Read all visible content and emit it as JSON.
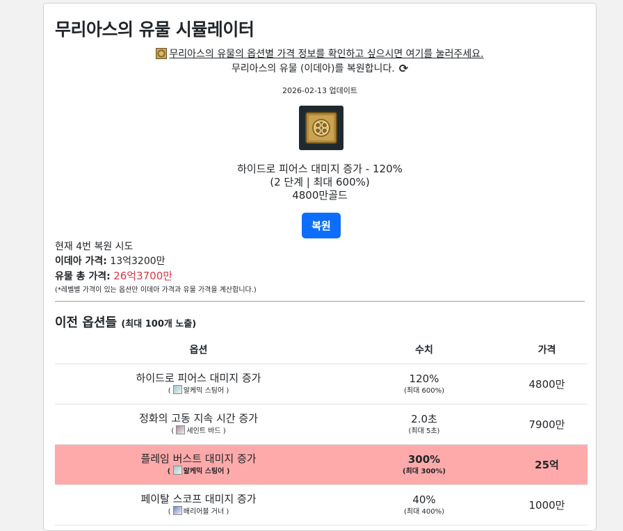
{
  "page": {
    "title": "무리아스의 유물 시뮬레이터",
    "link_text": "무리아스의 유물의 옵션별 가격 정보를 확인하고 싶으시면 여기를 눌러주세요.",
    "description": "무리아스의 유물 (이데아)를 복원합니다.",
    "update_text": "2026-02-13 업데이트"
  },
  "current_option": {
    "line1": "하이드로 피어스 대미지 증가 - 120%",
    "line2": "(2 단계 | 최대 600%)",
    "line3": "4800만골드"
  },
  "restore_button_label": "복원",
  "stats": {
    "attempts_text": "현재 4번 복원 시도",
    "idea_label": "이데아 가격:",
    "idea_value": "13억3200만",
    "total_label": "유물 총 가격:",
    "total_value": "26억3700만",
    "note": "(*레벨별 가격이 있는 옵션만 이데아 가격과 유물 가격을 계산합니다.)"
  },
  "history": {
    "heading": "이전 옵션들",
    "heading_small": "(최대 100개 노출)",
    "columns": [
      "옵션",
      "수치",
      "가격"
    ],
    "rows": [
      {
        "name": "하이드로 피어스 대미지 증가",
        "source": "알케믹 스팅어",
        "value": "120%",
        "max": "(최대 600%)",
        "price": "4800만",
        "gem_color": "#9cc9d8"
      },
      {
        "name": "정화의 고동 지속 시간 증가",
        "source": "세인트 바드",
        "value": "2.0초",
        "max": "(최대 5초)",
        "price": "7900만",
        "gem_color": "#a88a9a"
      },
      {
        "name": "플레임 버스트 대미지 증가",
        "source": "알케믹 스팅어",
        "value": "300%",
        "max": "(최대 300%)",
        "price": "25억",
        "gem_color": "#9cc9d8"
      },
      {
        "name": "페이탈 스코프 대미지 증가",
        "source": "배리어블 거너",
        "value": "40%",
        "max": "(최대 400%)",
        "price": "1000만",
        "gem_color": "#6a8ad0"
      }
    ]
  },
  "colors": {
    "primary_button": "#0d6efd",
    "highlight_row": "#ffaaaa",
    "total_price": "#dc3545"
  }
}
